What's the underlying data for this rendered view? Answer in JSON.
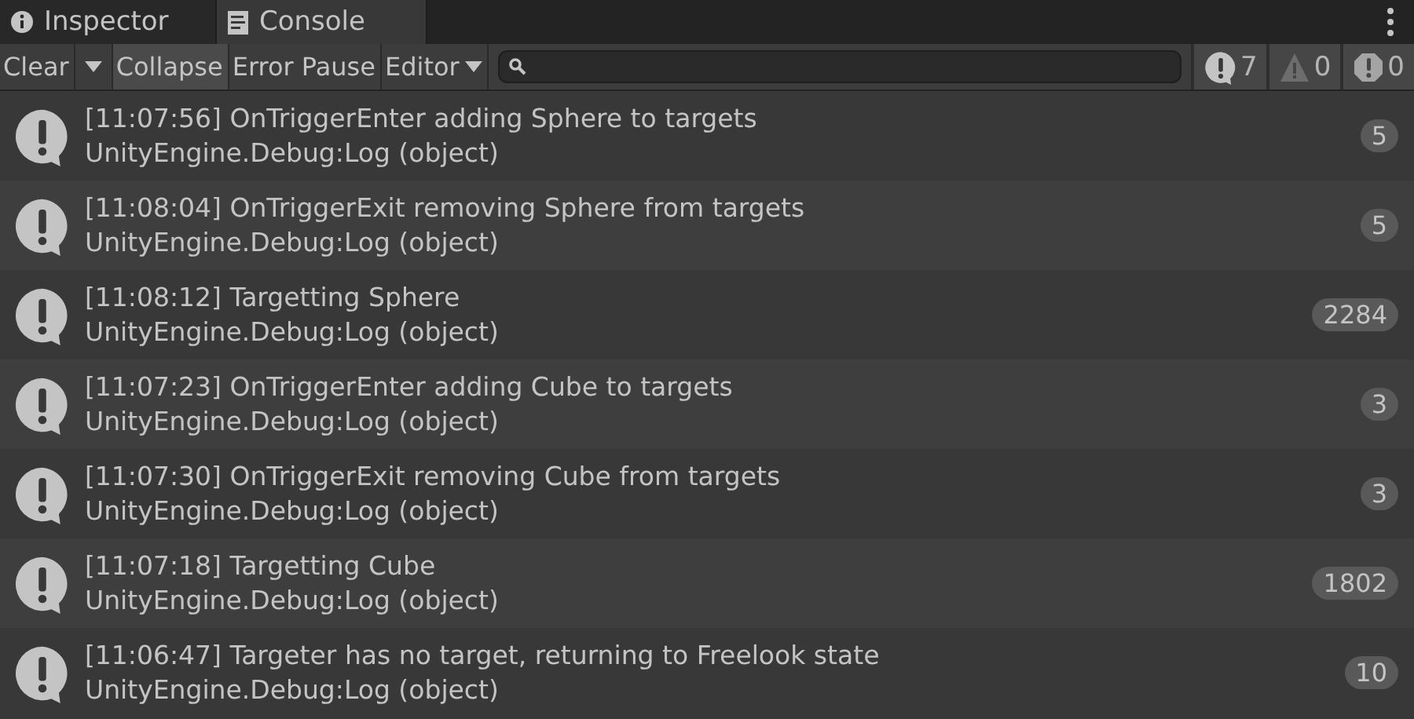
{
  "tabs": [
    {
      "label": "Inspector",
      "kind": "info",
      "selected": false
    },
    {
      "label": "Console",
      "kind": "console",
      "selected": true
    }
  ],
  "toolbar": {
    "buttons": [
      {
        "label": "Clear",
        "selected": false
      },
      {
        "label": "Collapse",
        "selected": true
      },
      {
        "label": "Error Pause",
        "selected": false
      }
    ],
    "editor": "Editor",
    "counters": [
      {
        "kind": "log",
        "count": "7"
      },
      {
        "kind": "warning",
        "count": "0"
      },
      {
        "kind": "error",
        "count": "0"
      }
    ]
  },
  "messages": [
    {
      "text": "[11:07:56] OnTriggerEnter adding Sphere to targets",
      "source": "UnityEngine.Debug:Log (object)",
      "count": "5"
    },
    {
      "text": "[11:08:04] OnTriggerExit removing Sphere from targets",
      "source": "UnityEngine.Debug:Log (object)",
      "count": "5"
    },
    {
      "text": "[11:08:12] Targetting Sphere",
      "source": "UnityEngine.Debug:Log (object)",
      "count": "2284"
    },
    {
      "text": "[11:07:23] OnTriggerEnter adding Cube to targets",
      "source": "UnityEngine.Debug:Log (object)",
      "count": "3"
    },
    {
      "text": "[11:07:30] OnTriggerExit removing Cube from targets",
      "source": "UnityEngine.Debug:Log (object)",
      "count": "3"
    },
    {
      "text": "[11:07:18] Targetting Cube",
      "source": "UnityEngine.Debug:Log (object)",
      "count": "1802"
    },
    {
      "text": "[11:06:47] Targeter has no target, returning to Freelook state",
      "source": "UnityEngine.Debug:Log (object)",
      "count": "10"
    }
  ]
}
